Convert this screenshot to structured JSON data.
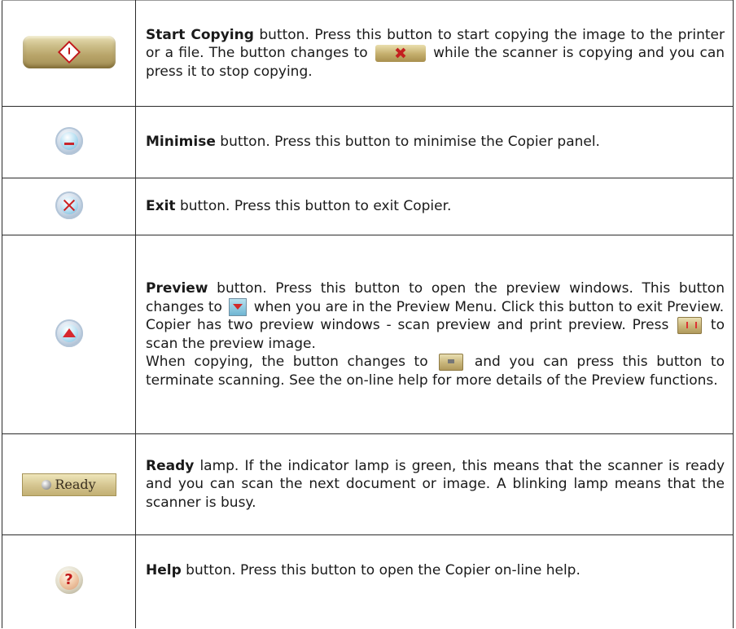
{
  "rows": [
    {
      "icon": "start-copying-icon",
      "term": "Start Copying",
      "text_1": " button. Press this button to start copying the image to the printer or a file. The button changes to",
      "inline_icon": "stop-copying-icon",
      "text_2": " while the scanner is copying and you can press it to stop copying."
    },
    {
      "icon": "minimise-icon",
      "term": "Minimise",
      "text": " button. Press this button to minimise the Copier panel."
    },
    {
      "icon": "exit-icon",
      "term": "Exit",
      "text": " button. Press this button to exit Copier."
    },
    {
      "icon": "preview-icon",
      "term": "Preview",
      "p1_a": " button. Press this button to open the preview windows. This button changes to",
      "p1_icon": "preview-down-icon",
      "p1_b": " when you are in the Preview Menu. Click this button to exit Preview.",
      "p2_a": "Copier has two preview windows - scan preview and print preview. Press",
      "p2_icon": "scan-preview-icon",
      "p2_b": " to scan the preview image.",
      "p3_a": "When copying, the button changes to",
      "p3_icon": "stop-scan-icon",
      "p3_b": " and you can press this button to terminate scanning. See the on-line help for more details of the Preview functions."
    },
    {
      "icon": "ready-lamp-icon",
      "lamp_label": "Ready",
      "term": "Ready",
      "text": " lamp. If the indicator lamp is green, this means that the scanner is ready and you can scan the next document or image. A blinking lamp means that the scanner is busy."
    },
    {
      "icon": "help-icon",
      "help_glyph": "?",
      "term": "Help",
      "text": " button. Press this button to open the Copier on-line help."
    }
  ]
}
